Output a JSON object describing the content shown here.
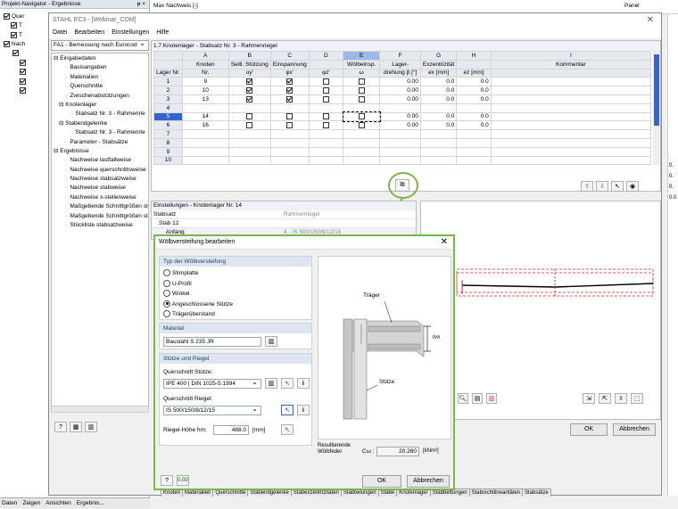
{
  "navigator": {
    "title": "Projekt-Navigator - Ergebnisse",
    "title_icons": "ᵽ ×",
    "tree": [
      "Quer",
      "T",
      "T",
      "Nach",
      "",
      "",
      "",
      "",
      ""
    ],
    "tabs": [
      "Daten",
      "Zeigen",
      "Ansichten",
      "Ergebnis..."
    ]
  },
  "bg_top": {
    "max_nachweis": "Max Nachweis [-]",
    "panel": "Panel"
  },
  "main_window": {
    "title": "STAHL EC3 - [Webinar_COM]",
    "menu": [
      "Datei",
      "Bearbeiten",
      "Einstellungen",
      "Hilfe"
    ],
    "case": "FA1 - Bemessung nach Eurocod",
    "nav": [
      {
        "t": "Eingabedaten",
        "l": 0
      },
      {
        "t": "Basisangaben",
        "l": 2
      },
      {
        "t": "Materialien",
        "l": 2
      },
      {
        "t": "Querschnitte",
        "l": 2
      },
      {
        "t": "Zwischenabstützungen",
        "l": 2
      },
      {
        "t": "Knotenlager",
        "l": 1
      },
      {
        "t": "Stabsatz Nr. 3 - Rahmenrie",
        "l": 3
      },
      {
        "t": "Stabendgelenke",
        "l": 1
      },
      {
        "t": "Stabsatz Nr. 3 - Rahmenrie",
        "l": 3
      },
      {
        "t": "Parameter - Stabsätze",
        "l": 2
      },
      {
        "t": "Ergebnisse",
        "l": 0
      },
      {
        "t": "Nachweise lastfallweise",
        "l": 2
      },
      {
        "t": "Nachweise querschnittsweise",
        "l": 2
      },
      {
        "t": "Nachweise stabsatzweise",
        "l": 2
      },
      {
        "t": "Nachweise stabweise",
        "l": 2
      },
      {
        "t": "Nachweise x-stellenweise",
        "l": 2
      },
      {
        "t": "Maßgebende Schnittgrößen sta",
        "l": 2
      },
      {
        "t": "Maßgebende Schnittgrößen sta",
        "l": 2
      },
      {
        "t": "Stückliste stabsatzweise",
        "l": 2
      }
    ],
    "table_title": "1.7 Knotenlager - Stabsatz Nr. 3 - Rahmenriegel",
    "col_letters": [
      "A",
      "B",
      "C",
      "D",
      "E",
      "F",
      "G",
      "H",
      "I"
    ],
    "col_groups": [
      "Knoten",
      "Seitl. Stützung",
      "Einspannung",
      "",
      "Wölbeinsp.",
      "Lager-",
      "Exzentrizität",
      "",
      "Kommentar"
    ],
    "col_sub": [
      "Lager Nr.",
      "Nr.",
      "uy'",
      "φx'",
      "φz'",
      "ω",
      "drehung β [°]",
      "ex [mm]",
      "ez [mm]",
      ""
    ],
    "rows": [
      {
        "n": "1",
        "k": "9",
        "u": true,
        "px": true,
        "pz": false,
        "w": false,
        "b": "0.00",
        "ex": "0.0",
        "ez": "0.0"
      },
      {
        "n": "2",
        "k": "10",
        "u": true,
        "px": true,
        "pz": false,
        "w": false,
        "b": "0.00",
        "ex": "0.0",
        "ez": "0.0"
      },
      {
        "n": "3",
        "k": "13",
        "u": true,
        "px": true,
        "pz": false,
        "w": false,
        "b": "0.00",
        "ex": "0.0",
        "ez": "0.0"
      },
      {
        "n": "4",
        "k": "",
        "u": null,
        "px": null,
        "pz": null,
        "w": null,
        "b": "",
        "ex": "",
        "ez": ""
      },
      {
        "n": "5",
        "k": "14",
        "u": false,
        "px": false,
        "pz": false,
        "w": false,
        "b": "0.00",
        "ex": "0.0",
        "ez": "0.0"
      },
      {
        "n": "6",
        "k": "16",
        "u": false,
        "px": false,
        "pz": false,
        "w": false,
        "b": "0.00",
        "ex": "0.0",
        "ez": "0.0"
      },
      {
        "n": "7",
        "k": ""
      },
      {
        "n": "8",
        "k": ""
      },
      {
        "n": "9",
        "k": ""
      },
      {
        "n": "10",
        "k": ""
      }
    ],
    "settings_title": "Einstellungen - Knotenlager Nr. 14",
    "settings": [
      {
        "k": "Stabsatz",
        "v": "Rahmenriegel"
      },
      {
        "k": "Stab 12",
        "v": ""
      },
      {
        "k": "Anfang",
        "v": "4 - IS 500/150/8/12/15"
      }
    ],
    "right_vals": [
      "0.",
      "0.",
      "0.",
      "0.0"
    ],
    "ok": "OK",
    "cancel": "Abbrechen",
    "bottom_tabs": [
      "Knoten",
      "Materialien",
      "Querschnitte",
      "Stabendgelenke",
      "Stabexzentrizitäten",
      "Stabteilungen",
      "Stäbe",
      "Knotenlager",
      "Stabbettungen",
      "Stabnichtlinearitäten",
      "Stabsätze"
    ],
    "bottom_right": "Panel"
  },
  "dialog": {
    "title": "Wölbversteifung bearbeiten",
    "type_title": "Typ der Wölbversteifung",
    "options": [
      "Stirnplatte",
      "U-Profil",
      "Winkel",
      "Angeschlossene Stütze",
      "Trägerüberstand"
    ],
    "selected": 3,
    "material_title": "Material",
    "material": "Baustahl S 235 JR",
    "stuetze_title": "Stütze und Riegel",
    "qs_stuetze_label": "Querschnitt Stütze:",
    "qs_stuetze": "IPE 400 | DIN 1025-5:1994",
    "qs_riegel_label": "Querschnitt Riegel:",
    "qs_riegel": "IS 500/150/8/12/15",
    "hohe_label": "Riegel-Höhe hm:",
    "hohe": "488.0",
    "hohe_unit": "[mm]",
    "img_traeger": "Träger",
    "img_stuetze": "Stütze",
    "img_hm": "hm",
    "result_label": "Resultierende Wölbfeder",
    "result_sym": "Cω :",
    "result": "20.260",
    "result_unit": "[kNm³]",
    "ok": "OK",
    "cancel": "Abbrechen"
  },
  "colors": {
    "accent_green": "#7ab648",
    "selected_row": "#3366cc",
    "header_blue": "#dde6f0",
    "red": "#e02020"
  }
}
